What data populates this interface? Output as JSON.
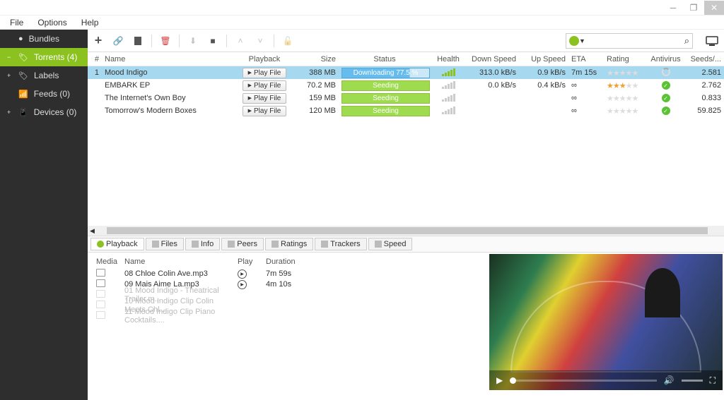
{
  "menu": {
    "file": "File",
    "options": "Options",
    "help": "Help"
  },
  "sidebar": {
    "items": [
      {
        "label": "Bundles",
        "exp": ""
      },
      {
        "label": "Torrents (4)",
        "exp": "−"
      },
      {
        "label": "Labels",
        "exp": "+"
      },
      {
        "label": "Feeds (0)",
        "exp": ""
      },
      {
        "label": "Devices (0)",
        "exp": "+"
      }
    ]
  },
  "columns": {
    "num": "#",
    "name": "Name",
    "playback": "Playback",
    "size": "Size",
    "status": "Status",
    "health": "Health",
    "down": "Down Speed",
    "up": "Up Speed",
    "eta": "ETA",
    "rating": "Rating",
    "antivirus": "Antivirus",
    "seeds": "Seeds/..."
  },
  "torrents": [
    {
      "num": "1",
      "name": "Mood Indigo",
      "play": "Play File",
      "size": "388 MB",
      "status": "Downloading 77.5 %",
      "status_type": "dl",
      "health": 5,
      "down": "313.0 kB/s",
      "up": "0.9 kB/s",
      "eta": "7m 15s",
      "stars": 0,
      "av": "wait",
      "seeds": "2.581",
      "sel": true
    },
    {
      "num": "",
      "name": "EMBARK EP",
      "play": "Play File",
      "size": "70.2 MB",
      "status": "Seeding",
      "status_type": "seed",
      "health": 0,
      "down": "0.0 kB/s",
      "up": "0.4 kB/s",
      "eta": "∞",
      "stars": 3,
      "av": "ok",
      "seeds": "2.762"
    },
    {
      "num": "",
      "name": "The Internet's Own Boy",
      "play": "Play File",
      "size": "159 MB",
      "status": "Seeding",
      "status_type": "seed",
      "health": 0,
      "down": "",
      "up": "",
      "eta": "∞",
      "stars": 0,
      "av": "ok",
      "seeds": "0.833"
    },
    {
      "num": "",
      "name": "Tomorrow's Modern Boxes",
      "play": "Play File",
      "size": "120 MB",
      "status": "Seeding",
      "status_type": "seed",
      "health": 0,
      "down": "",
      "up": "",
      "eta": "∞",
      "stars": 0,
      "av": "ok",
      "seeds": "59.825"
    }
  ],
  "tabs": [
    "Playback",
    "Files",
    "Info",
    "Peers",
    "Ratings",
    "Trackers",
    "Speed"
  ],
  "filecols": {
    "media": "Media",
    "name": "Name",
    "play": "Play",
    "dur": "Duration"
  },
  "files": [
    {
      "name": "08 Chloe Colin Ave.mp3",
      "dur": "7m 59s",
      "type": "audio",
      "playable": true
    },
    {
      "name": "09 Mais Aime La.mp3",
      "dur": "4m 10s",
      "type": "audio",
      "playable": true
    },
    {
      "name": "01 Mood Indigo - Theatrical Trailer.m...",
      "dur": "",
      "type": "video",
      "playable": false
    },
    {
      "name": "10 Mood Indigo Clip Colin Meets Chl...",
      "dur": "",
      "type": "video",
      "playable": false
    },
    {
      "name": "11 Mood Indigo Clip Piano Cocktails....",
      "dur": "",
      "type": "video",
      "playable": false
    }
  ]
}
